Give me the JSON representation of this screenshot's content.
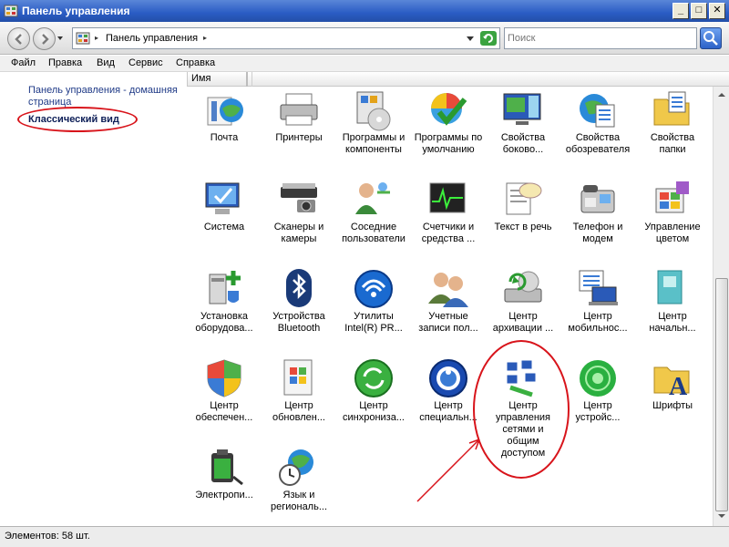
{
  "window": {
    "title": "Панель управления"
  },
  "nav": {
    "address_text": "Панель управления",
    "address_arrow": "▸",
    "search_placeholder": "Поиск"
  },
  "menu": [
    "Файл",
    "Правка",
    "Вид",
    "Сервис",
    "Справка"
  ],
  "left_pane": {
    "home_link": "Панель управления - домашняя страница",
    "classic_view": "Классический вид"
  },
  "columns": {
    "name": "Имя"
  },
  "items": [
    {
      "label": "Почта",
      "icon": "mail-icon"
    },
    {
      "label": "Принтеры",
      "icon": "printer-icon"
    },
    {
      "label": "Программы и компоненты",
      "icon": "programs-icon"
    },
    {
      "label": "Программы по умолчанию",
      "icon": "default-programs-icon"
    },
    {
      "label": "Свойства боково...",
      "icon": "sidebar-icon"
    },
    {
      "label": "Свойства обозревателя",
      "icon": "internet-options-icon"
    },
    {
      "label": "Свойства папки",
      "icon": "folder-options-icon"
    },
    {
      "label": "Система",
      "icon": "system-icon"
    },
    {
      "label": "Сканеры и камеры",
      "icon": "scanner-icon"
    },
    {
      "label": "Соседние пользователи",
      "icon": "people-near-me-icon"
    },
    {
      "label": "Счетчики и средства ...",
      "icon": "performance-icon"
    },
    {
      "label": "Текст в речь",
      "icon": "text-to-speech-icon"
    },
    {
      "label": "Телефон и модем",
      "icon": "phone-modem-icon"
    },
    {
      "label": "Управление цветом",
      "icon": "color-management-icon"
    },
    {
      "label": "Установка оборудова...",
      "icon": "add-hardware-icon"
    },
    {
      "label": "Устройства Bluetooth",
      "icon": "bluetooth-icon"
    },
    {
      "label": "Утилиты Intel(R) PR...",
      "icon": "intel-wireless-icon"
    },
    {
      "label": "Учетные записи пол...",
      "icon": "user-accounts-icon"
    },
    {
      "label": "Центр архивации ...",
      "icon": "backup-icon"
    },
    {
      "label": "Центр мобильнос...",
      "icon": "mobility-icon"
    },
    {
      "label": "Центр начальн...",
      "icon": "welcome-center-icon"
    },
    {
      "label": "Центр обеспечен...",
      "icon": "security-center-icon"
    },
    {
      "label": "Центр обновлен...",
      "icon": "windows-update-icon"
    },
    {
      "label": "Центр синхрониза...",
      "icon": "sync-center-icon"
    },
    {
      "label": "Центр специальн...",
      "icon": "ease-of-access-icon"
    },
    {
      "label": "Центр управления сетями и общим доступом",
      "icon": "network-center-icon"
    },
    {
      "label": "Центр устройс...",
      "icon": "device-center-icon"
    },
    {
      "label": "Шрифты",
      "icon": "fonts-icon"
    },
    {
      "label": "Электропи...",
      "icon": "power-options-icon"
    },
    {
      "label": "Язык и региональ...",
      "icon": "region-language-icon"
    }
  ],
  "status": {
    "count": "Элементов: 58 шт."
  },
  "colors": {
    "annotation": "#d8141b",
    "title_bar": "#2a5cc4"
  }
}
